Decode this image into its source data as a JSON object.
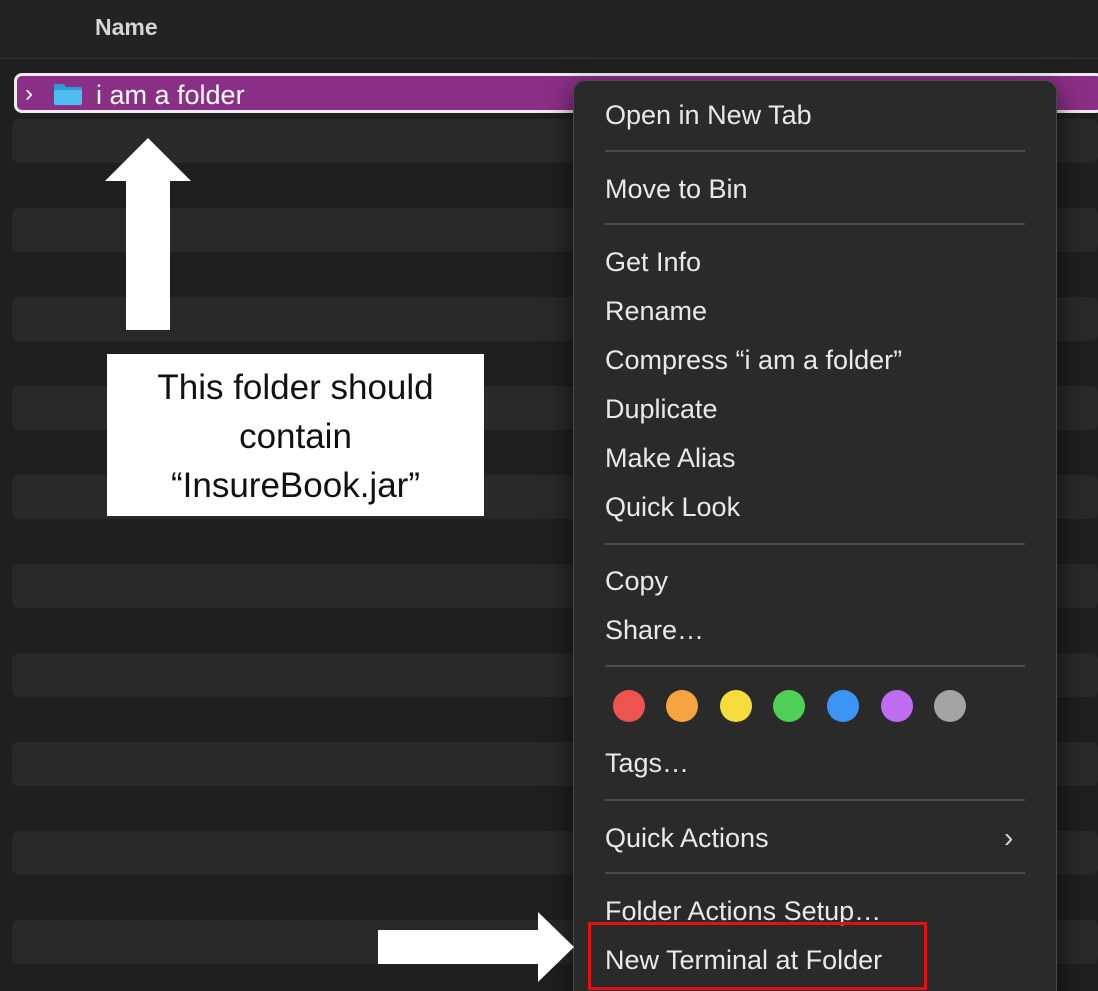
{
  "header": {
    "name_label": "Name"
  },
  "file_list": {
    "selected_item": {
      "name": "i am a folder",
      "disclosure": "›"
    }
  },
  "annotation": {
    "callout_lines": [
      "This folder should",
      "contain",
      "“InsureBook.jar”"
    ]
  },
  "context_menu": {
    "open_new_tab": "Open in New Tab",
    "move_to_bin": "Move to Bin",
    "get_info": "Get Info",
    "rename": "Rename",
    "compress": "Compress “i am a folder”",
    "duplicate": "Duplicate",
    "make_alias": "Make Alias",
    "quick_look": "Quick Look",
    "copy": "Copy",
    "share": "Share…",
    "tags": "Tags…",
    "quick_actions": "Quick Actions",
    "folder_actions_setup": "Folder Actions Setup…",
    "new_terminal": "New Terminal at Folder",
    "chevron": "›"
  },
  "tag_colors": [
    {
      "name": "red",
      "color": "#ef5350"
    },
    {
      "name": "orange",
      "color": "#f6a440"
    },
    {
      "name": "yellow",
      "color": "#f5dc3b"
    },
    {
      "name": "green",
      "color": "#4fcf55"
    },
    {
      "name": "blue",
      "color": "#3c95f5"
    },
    {
      "name": "purple",
      "color": "#c06cf0"
    },
    {
      "name": "gray",
      "color": "#a4a4a6"
    }
  ],
  "colors": {
    "selection": "#8a2f86",
    "folder_icon": "#39aee8",
    "highlight": "#e01212",
    "arrow": "#ffffff"
  }
}
